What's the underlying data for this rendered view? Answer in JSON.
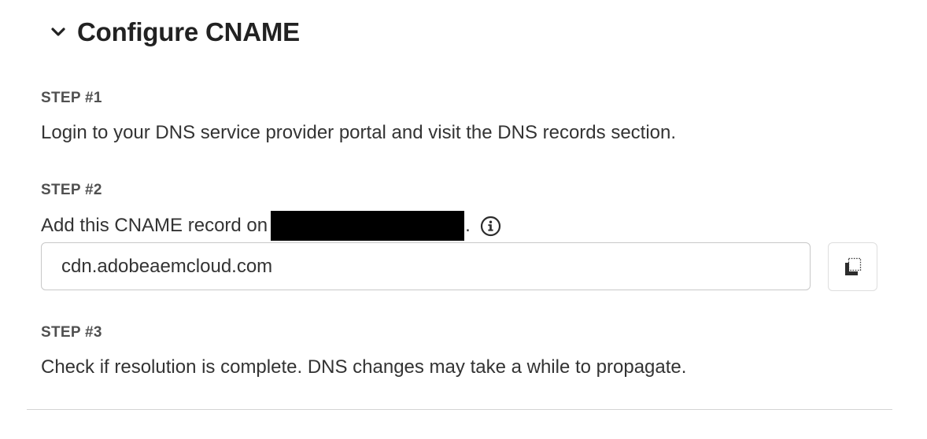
{
  "section": {
    "title": "Configure CNAME",
    "chevron_icon": "chevron-down-icon",
    "expanded": true
  },
  "steps": [
    {
      "label": "STEP #1",
      "text": "Login to your DNS service provider portal and visit the DNS records section."
    },
    {
      "label": "STEP #2",
      "text_prefix": "Add this CNAME record on",
      "text_suffix": ".",
      "info_icon": "info-icon",
      "cname_value": "cdn.adobeaemcloud.com",
      "copy_icon": "copy-icon"
    },
    {
      "label": "STEP #3",
      "text": "Check if resolution is complete. DNS changes may take a while to propagate."
    }
  ]
}
